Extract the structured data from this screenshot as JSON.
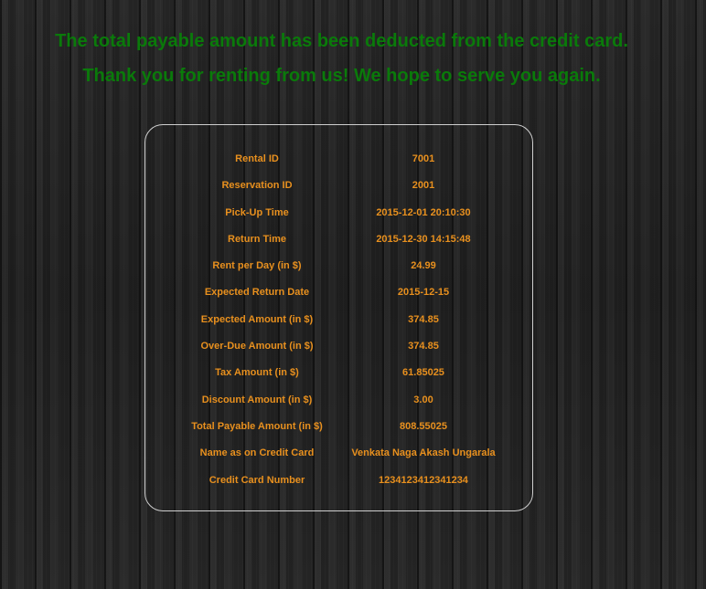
{
  "messages": {
    "deducted": "The total payable amount has been deducted from the credit card.",
    "thank_you": "Thank you for renting from us! We hope to serve you again."
  },
  "details": [
    {
      "label": "Rental ID",
      "value": "7001"
    },
    {
      "label": "Reservation ID",
      "value": "2001"
    },
    {
      "label": "Pick-Up Time",
      "value": "2015-12-01 20:10:30"
    },
    {
      "label": "Return Time",
      "value": "2015-12-30 14:15:48"
    },
    {
      "label": "Rent per Day (in $)",
      "value": "24.99"
    },
    {
      "label": "Expected Return Date",
      "value": "2015-12-15"
    },
    {
      "label": "Expected Amount (in $)",
      "value": "374.85"
    },
    {
      "label": "Over-Due Amount (in $)",
      "value": "374.85"
    },
    {
      "label": "Tax Amount (in $)",
      "value": "61.85025"
    },
    {
      "label": "Discount Amount (in $)",
      "value": "3.00"
    },
    {
      "label": "Total Payable Amount (in $)",
      "value": "808.55025"
    },
    {
      "label": "Name as on Credit Card",
      "value": "Venkata Naga Akash Ungarala"
    },
    {
      "label": "Credit Card Number",
      "value": "1234123412341234"
    }
  ],
  "colors": {
    "message_text": "#0a7a0a",
    "detail_text": "#e8901e",
    "panel_border": "#cfcfcf",
    "background": "#1b1b1b"
  }
}
